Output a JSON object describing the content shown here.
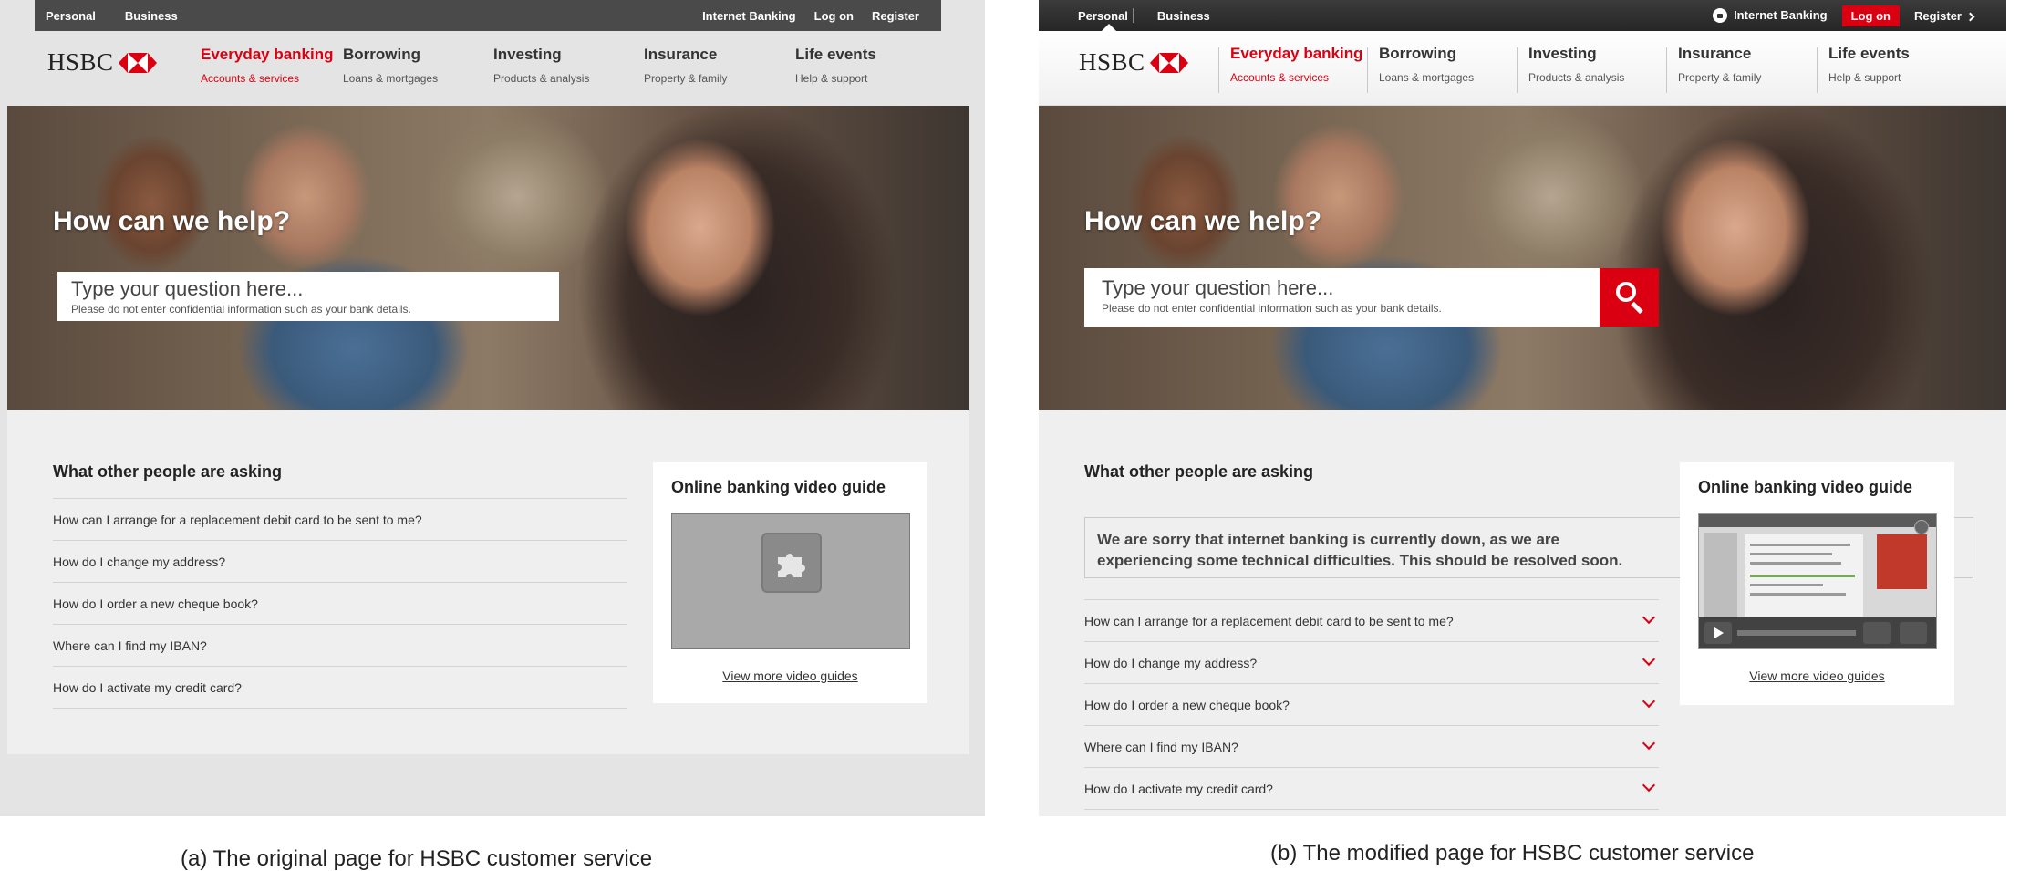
{
  "colors": {
    "brand_red": "#db0011",
    "topbar": "#4a4a4a",
    "page_bg": "#e4e4e4",
    "content_bg": "#efefef"
  },
  "topbar": {
    "personal": "Personal",
    "business": "Business",
    "internet_banking": "Internet Banking",
    "log_on": "Log on",
    "register": "Register"
  },
  "logo": {
    "text": "HSBC",
    "icon": "hsbc-hexagon-icon"
  },
  "nav": [
    {
      "title": "Everyday banking",
      "sub": "Accounts & services"
    },
    {
      "title": "Borrowing",
      "sub": "Loans & mortgages"
    },
    {
      "title": "Investing",
      "sub": "Products & analysis"
    },
    {
      "title": "Insurance",
      "sub": "Property & family"
    },
    {
      "title": "Life events",
      "sub": "Help & support"
    }
  ],
  "hero": {
    "title": "How can we help?",
    "search_placeholder": "Type your question here...",
    "search_note": "Please do not enter confidential information such as your bank details."
  },
  "faq": {
    "title": "What other people are asking",
    "items": [
      "How can I arrange for a replacement debit card to be sent to me?",
      "How do I change my address?",
      "How do I order a new cheque book?",
      "Where can I find my IBAN?",
      "How do I activate my credit card?"
    ]
  },
  "alert": {
    "line1": "We are sorry that internet banking is currently down, as we are",
    "line2": "experiencing some technical difficulties. This should be resolved soon."
  },
  "video": {
    "title": "Online banking video guide",
    "link": "View more video guides"
  },
  "captions": {
    "a": "(a) The original page for HSBC customer service",
    "b": "(b) The modified page for HSBC customer service"
  }
}
